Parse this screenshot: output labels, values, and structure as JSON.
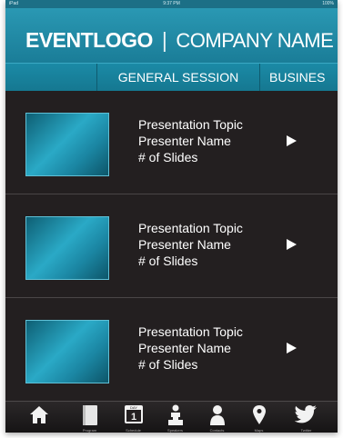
{
  "status_bar": {
    "carrier": "iPad",
    "time": "9:37 PM",
    "battery": "100%"
  },
  "header": {
    "logo_event": "EVENTLOGO",
    "logo_separator": "|",
    "logo_company": "COMPANY NAME"
  },
  "tabs": [
    {
      "label": "GENERAL SESSION"
    },
    {
      "label": "BUSINES"
    }
  ],
  "sessions": [
    {
      "topic": "Presentation Topic",
      "presenter": "Presenter Name",
      "slides": "# of Slides"
    },
    {
      "topic": "Presentation Topic",
      "presenter": "Presenter Name",
      "slides": "# of Slides"
    },
    {
      "topic": "Presentation Topic",
      "presenter": "Presenter Name",
      "slides": "# of Slides"
    }
  ],
  "bottom_nav": [
    {
      "label": "",
      "icon": "home-icon"
    },
    {
      "label": "Program",
      "icon": "book-icon"
    },
    {
      "label": "Schedule",
      "icon": "calendar-icon",
      "calendar_day": "1",
      "calendar_month": "DAY"
    },
    {
      "label": "Speakers",
      "icon": "speaker-icon"
    },
    {
      "label": "Contacts",
      "icon": "contact-icon"
    },
    {
      "label": "Maps",
      "icon": "map-pin-icon"
    },
    {
      "label": "Twitter",
      "icon": "twitter-bird-icon"
    }
  ],
  "colors": {
    "header": "#2a98b3",
    "tab_bar": "#1b8aa6",
    "background": "#231f20",
    "thumbnail": "#1b86a3"
  }
}
